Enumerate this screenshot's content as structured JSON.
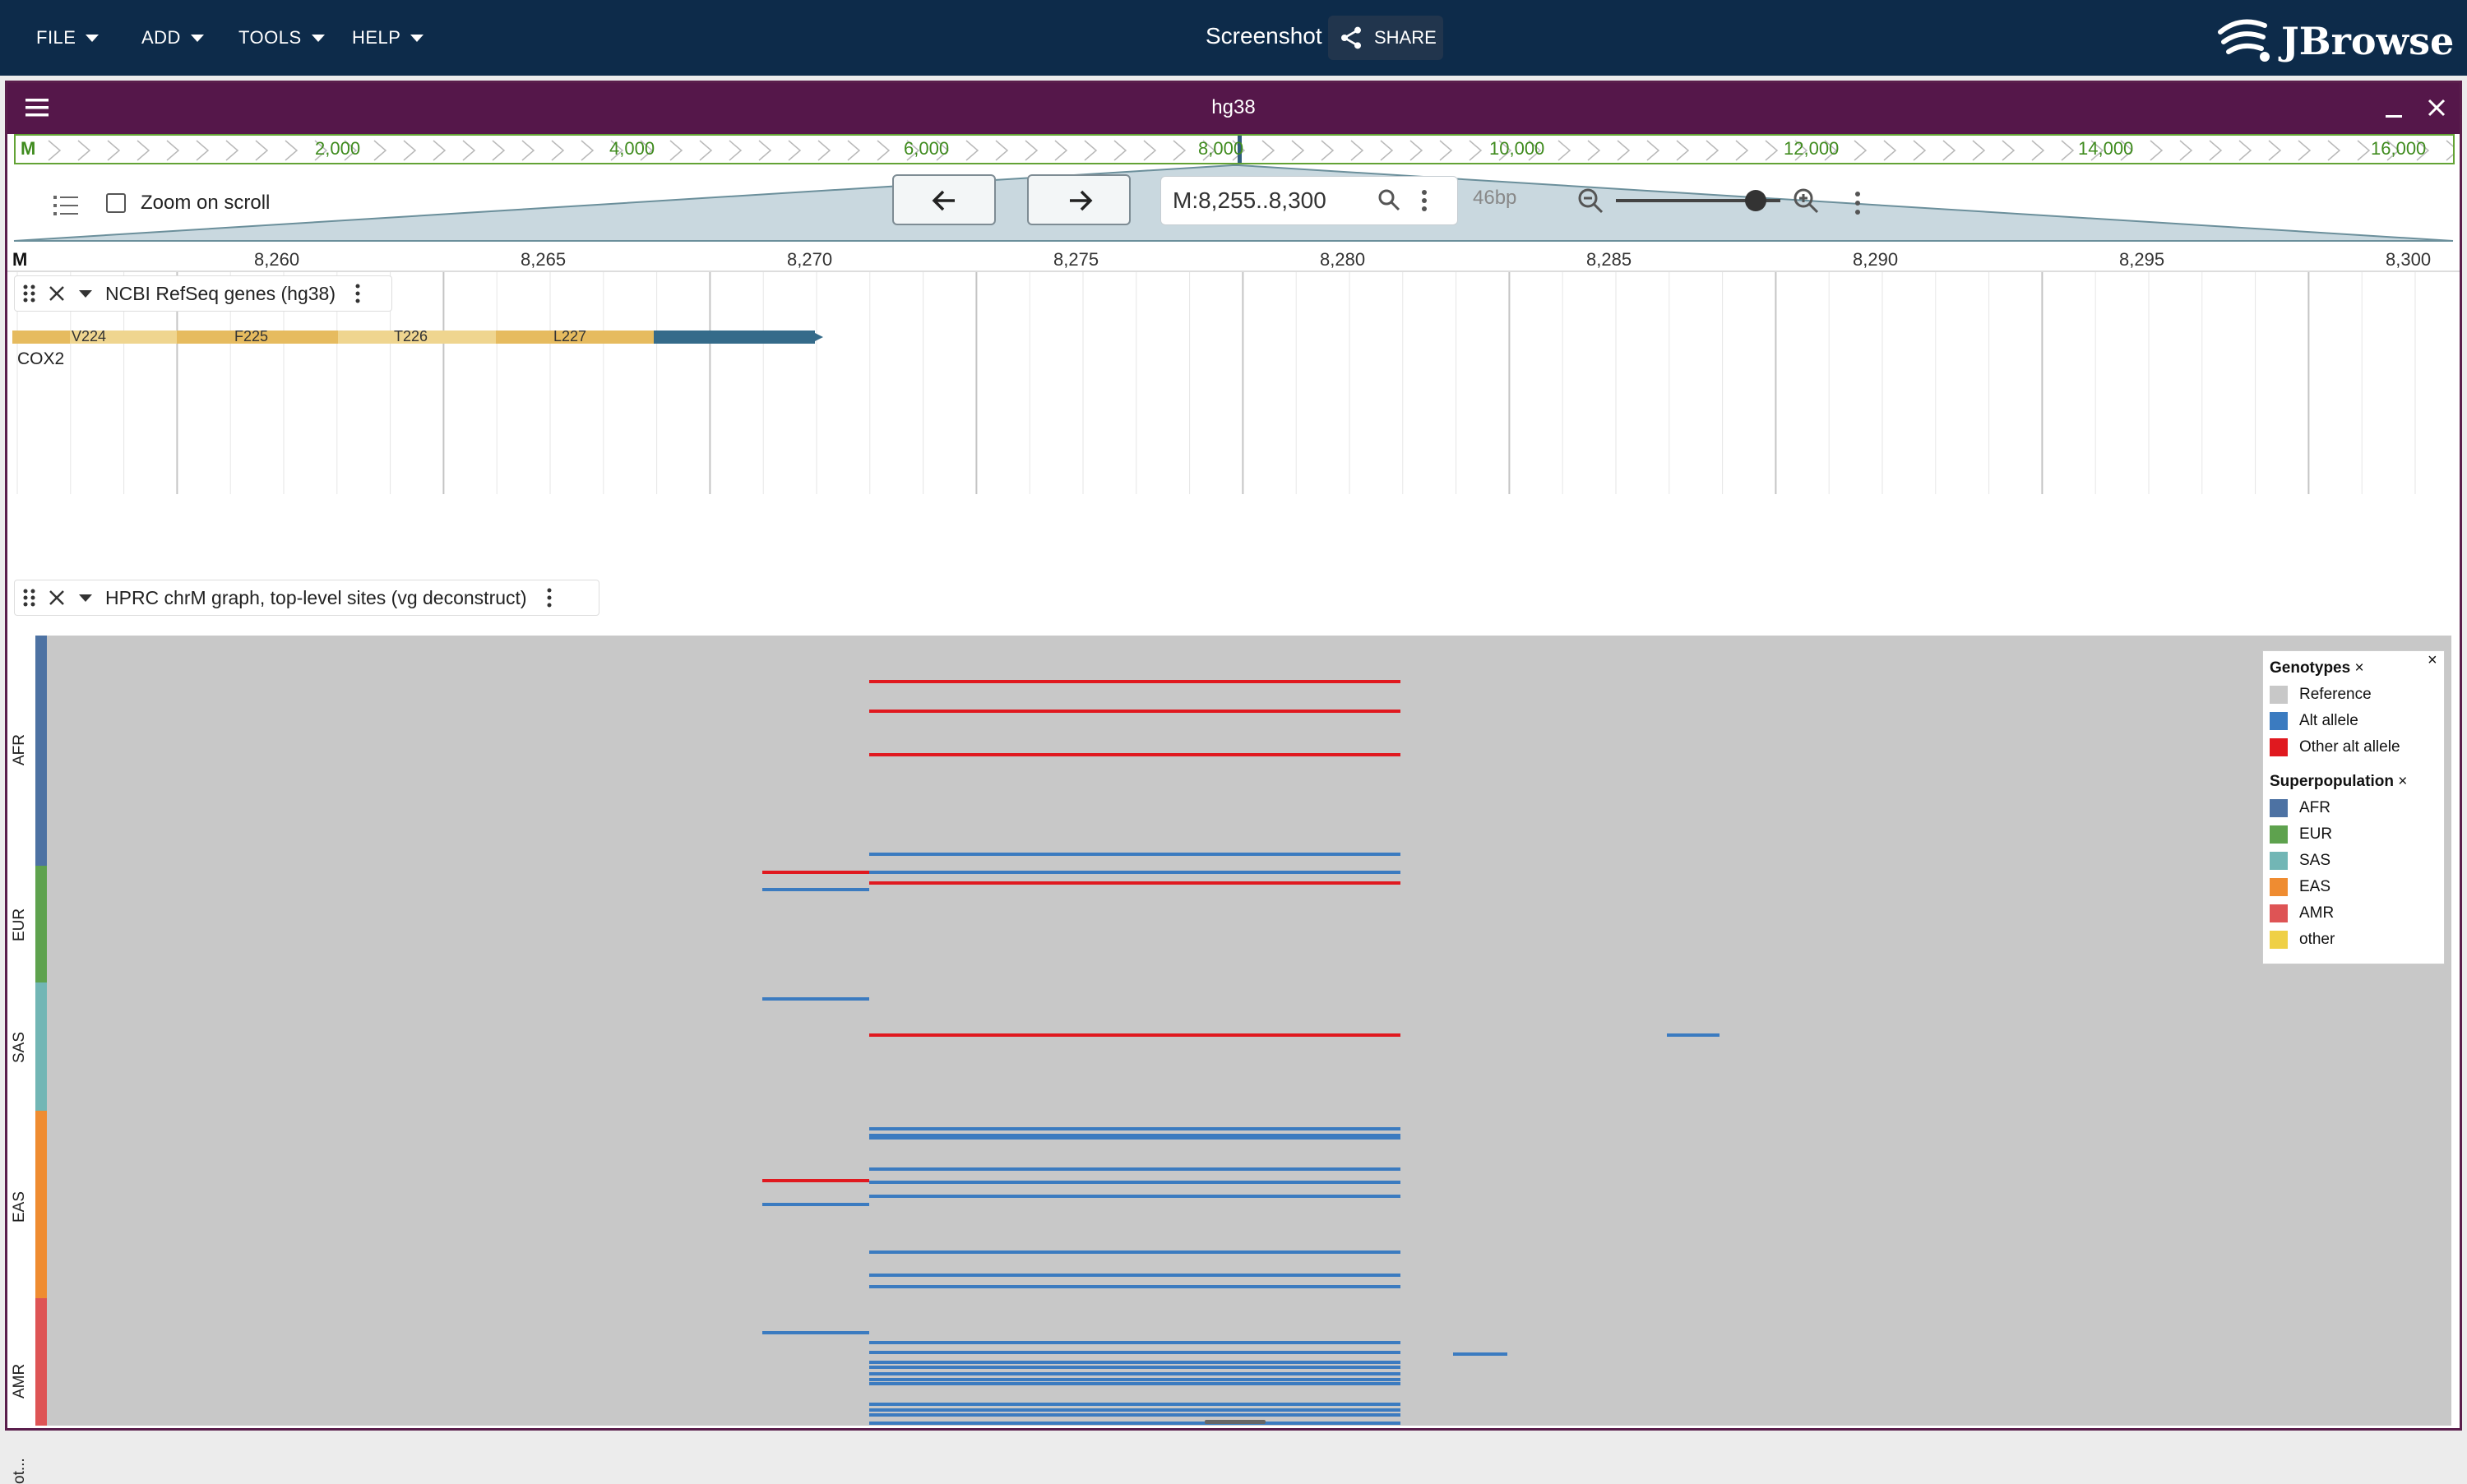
{
  "appbar": {
    "menus": [
      "FILE",
      "ADD",
      "TOOLS",
      "HELP"
    ],
    "session_name": "Screenshot",
    "share_label": "SHARE",
    "brand": "JBrowse"
  },
  "view": {
    "assembly": "hg38",
    "overview_ticks": [
      "M",
      "2,000",
      "4,000",
      "6,000",
      "8,000",
      "10,000",
      "12,000",
      "14,000",
      "16,000"
    ],
    "zoom_on_scroll_label": "Zoom on scroll",
    "zoom_on_scroll_checked": false,
    "locstring": "M:8,255..8,300",
    "bp_count": "46bp",
    "zoom_level": 0.9,
    "ruler_ticks": [
      "M",
      "8,260",
      "8,265",
      "8,270",
      "8,275",
      "8,280",
      "8,285",
      "8,290",
      "8,295",
      "8,300"
    ]
  },
  "tracks": [
    {
      "name": "NCBI RefSeq genes (hg38)",
      "gene_name": "COX2",
      "codons": [
        "V224",
        "F225",
        "T226",
        "L227"
      ]
    },
    {
      "name": "HPRC chrM graph, top-level sites (vg deconstruct)",
      "superpopulations": [
        "AFR",
        "EUR",
        "SAS",
        "EAS",
        "AMR",
        "ot..."
      ]
    }
  ],
  "legend": {
    "genotypes_title": "Genotypes",
    "genotypes": [
      {
        "label": "Reference",
        "color": "#c8c8c8"
      },
      {
        "label": "Alt allele",
        "color": "#3b7bc0"
      },
      {
        "label": "Other alt allele",
        "color": "#e0191f"
      }
    ],
    "superpop_title": "Superpopulation",
    "superpops": [
      {
        "label": "AFR",
        "color": "#4d72a3"
      },
      {
        "label": "EUR",
        "color": "#5ea24e"
      },
      {
        "label": "SAS",
        "color": "#72b6b5"
      },
      {
        "label": "EAS",
        "color": "#ef8c31"
      },
      {
        "label": "AMR",
        "color": "#de5455"
      },
      {
        "label": "other",
        "color": "#efd046"
      }
    ],
    "close_symbol": "×"
  },
  "colors": {
    "appbar": "#0d2b4a",
    "view_header": "#55174a",
    "codon_light": "#efd58f",
    "codon_dark": "#e6bb5f",
    "utr": "#356b8a",
    "reference": "#c8c8c8",
    "alt": "#3b7bc0",
    "other_alt": "#e0191f"
  }
}
